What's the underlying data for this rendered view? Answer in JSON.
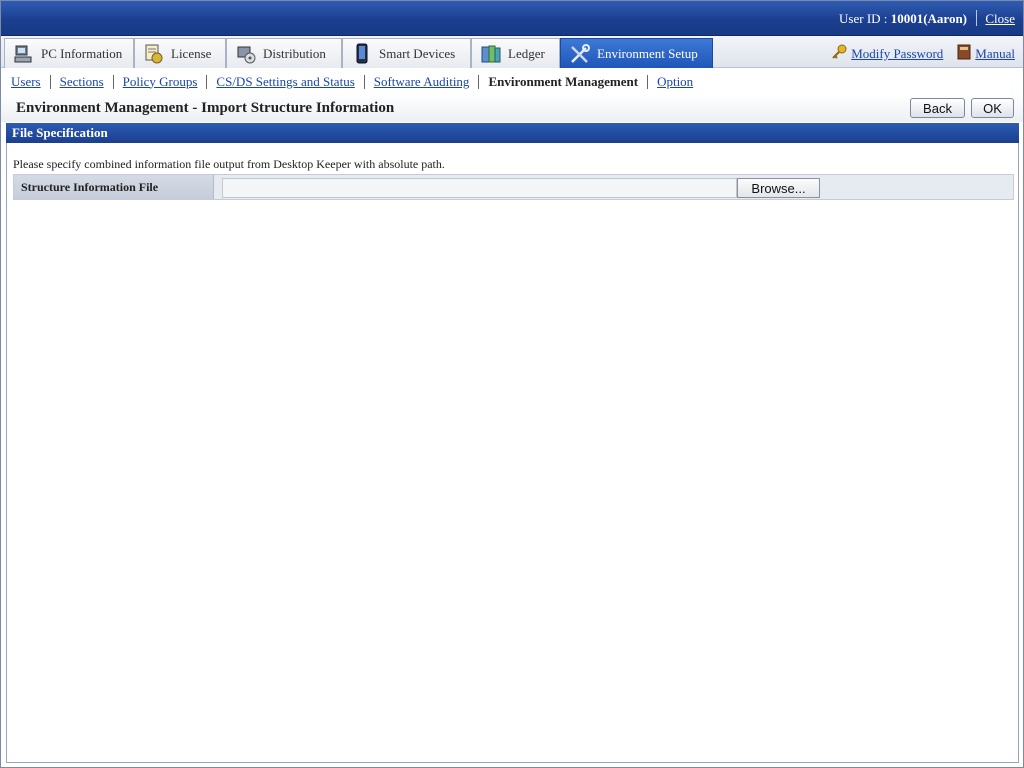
{
  "header": {
    "user_id_label": "User ID : ",
    "user_id_value": "10001(Aaron)",
    "close_label": "Close"
  },
  "tabs": [
    {
      "label": "PC Information",
      "icon": "pc-icon"
    },
    {
      "label": "License",
      "icon": "license-icon"
    },
    {
      "label": "Distribution",
      "icon": "distribution-icon"
    },
    {
      "label": "Smart Devices",
      "icon": "smart-device-icon"
    },
    {
      "label": "Ledger",
      "icon": "ledger-icon"
    },
    {
      "label": "Environment Setup",
      "icon": "tools-icon",
      "active": true
    }
  ],
  "right_links": {
    "modify_password": "Modify Password",
    "manual": "Manual"
  },
  "subnav": [
    {
      "label": "Users"
    },
    {
      "label": "Sections"
    },
    {
      "label": "Policy Groups"
    },
    {
      "label": "CS/DS Settings and Status"
    },
    {
      "label": "Software Auditing"
    },
    {
      "label": "Environment Management",
      "current": true
    },
    {
      "label": "Option"
    }
  ],
  "page": {
    "title": "Environment Management - Import Structure Information",
    "back_label": "Back",
    "ok_label": "OK"
  },
  "section": {
    "title": "File Specification",
    "instruction": "Please specify combined information file output from Desktop Keeper with absolute path.",
    "field_label": "Structure Information File",
    "field_value": "",
    "browse_label": "Browse..."
  },
  "colors": {
    "banner": "#1c3f8f",
    "active_tab": "#2a63c4",
    "link": "#1a45b0"
  }
}
